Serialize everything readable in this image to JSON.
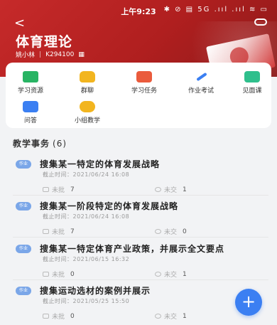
{
  "status_bar": {
    "time": "上午9:23",
    "icons": "✱ ⊘ ▤ 5G .ııl .ııl ≋ ▭"
  },
  "course": {
    "title": "体育理论",
    "teacher": "姚小林",
    "code": "K294100",
    "qr_glyph": "▦"
  },
  "tools": [
    {
      "label": "学习资源",
      "icon": "folder-icon"
    },
    {
      "label": "群聊",
      "icon": "chat-icon"
    },
    {
      "label": "学习任务",
      "icon": "task-flag-icon"
    },
    {
      "label": "作业考试",
      "icon": "pen-icon"
    },
    {
      "label": "见面课",
      "icon": "video-icon"
    },
    {
      "label": "问答",
      "icon": "qa-icon"
    },
    {
      "label": "小组教学",
      "icon": "group-icon"
    }
  ],
  "section": {
    "title": "教学事务",
    "count": "(6)"
  },
  "tasks": [
    {
      "badge": "作业",
      "title": "搜集某一特定的体育发展战略",
      "deadline": "截止时间：2021/06/24 16:08",
      "unread_label": "未批",
      "unread_count": "7",
      "unsubmitted_label": "未交",
      "unsubmitted_count": "1"
    },
    {
      "badge": "作业",
      "title": "搜集某一阶段特定的体育发展战略",
      "deadline": "截止时间：2021/06/24 16:08",
      "unread_label": "未批",
      "unread_count": "7",
      "unsubmitted_label": "未交",
      "unsubmitted_count": "0"
    },
    {
      "badge": "作业",
      "title": "搜集某一特定体育产业政策，并展示全文要点",
      "deadline": "截止时间：2021/06/15 16:32",
      "unread_label": "未批",
      "unread_count": "0",
      "unsubmitted_label": "未交",
      "unsubmitted_count": "1"
    },
    {
      "badge": "作业",
      "title": "搜集运动选材的案例并展示",
      "deadline": "截止时间：2021/05/25 15:50",
      "unread_label": "未批",
      "unread_count": "0",
      "unsubmitted_label": "未交",
      "unsubmitted_count": "1"
    }
  ],
  "fab": {
    "label": "+"
  },
  "colors": {
    "brand": "#c62a2a",
    "accent": "#3b7ff2"
  }
}
